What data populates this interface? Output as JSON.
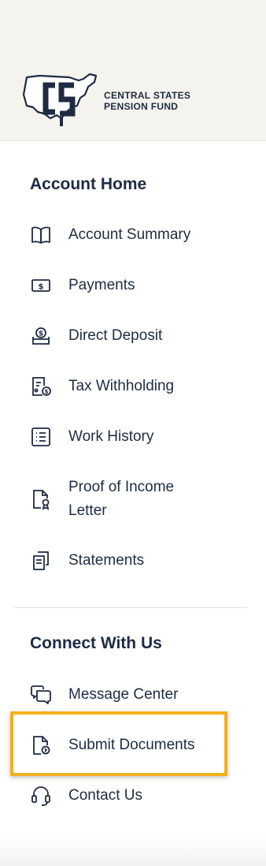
{
  "brand": {
    "logo_icon": "csf-us-map-logo",
    "line1": "CENTRAL STATES",
    "line2": "PENSION FUND",
    "color": "#1e2b43"
  },
  "sections": {
    "account_home": {
      "title": "Account Home",
      "items": [
        {
          "label": "Account Summary",
          "icon": "open-book-icon"
        },
        {
          "label": "Payments",
          "icon": "dollar-bill-icon"
        },
        {
          "label": "Direct Deposit",
          "icon": "deposit-coin-icon"
        },
        {
          "label": "Tax Withholding",
          "icon": "tax-document-icon"
        },
        {
          "label": "Work History",
          "icon": "list-icon"
        },
        {
          "label": "Proof of Income Letter",
          "icon": "certified-document-icon"
        },
        {
          "label": "Statements",
          "icon": "documents-icon"
        }
      ]
    },
    "connect": {
      "title": "Connect With Us",
      "items": [
        {
          "label": "Message Center",
          "icon": "chat-bubbles-icon"
        },
        {
          "label": "Submit Documents",
          "icon": "document-upload-icon"
        },
        {
          "label": "Contact Us",
          "icon": "headset-icon"
        }
      ]
    }
  },
  "highlight_color": "#f2b01e"
}
